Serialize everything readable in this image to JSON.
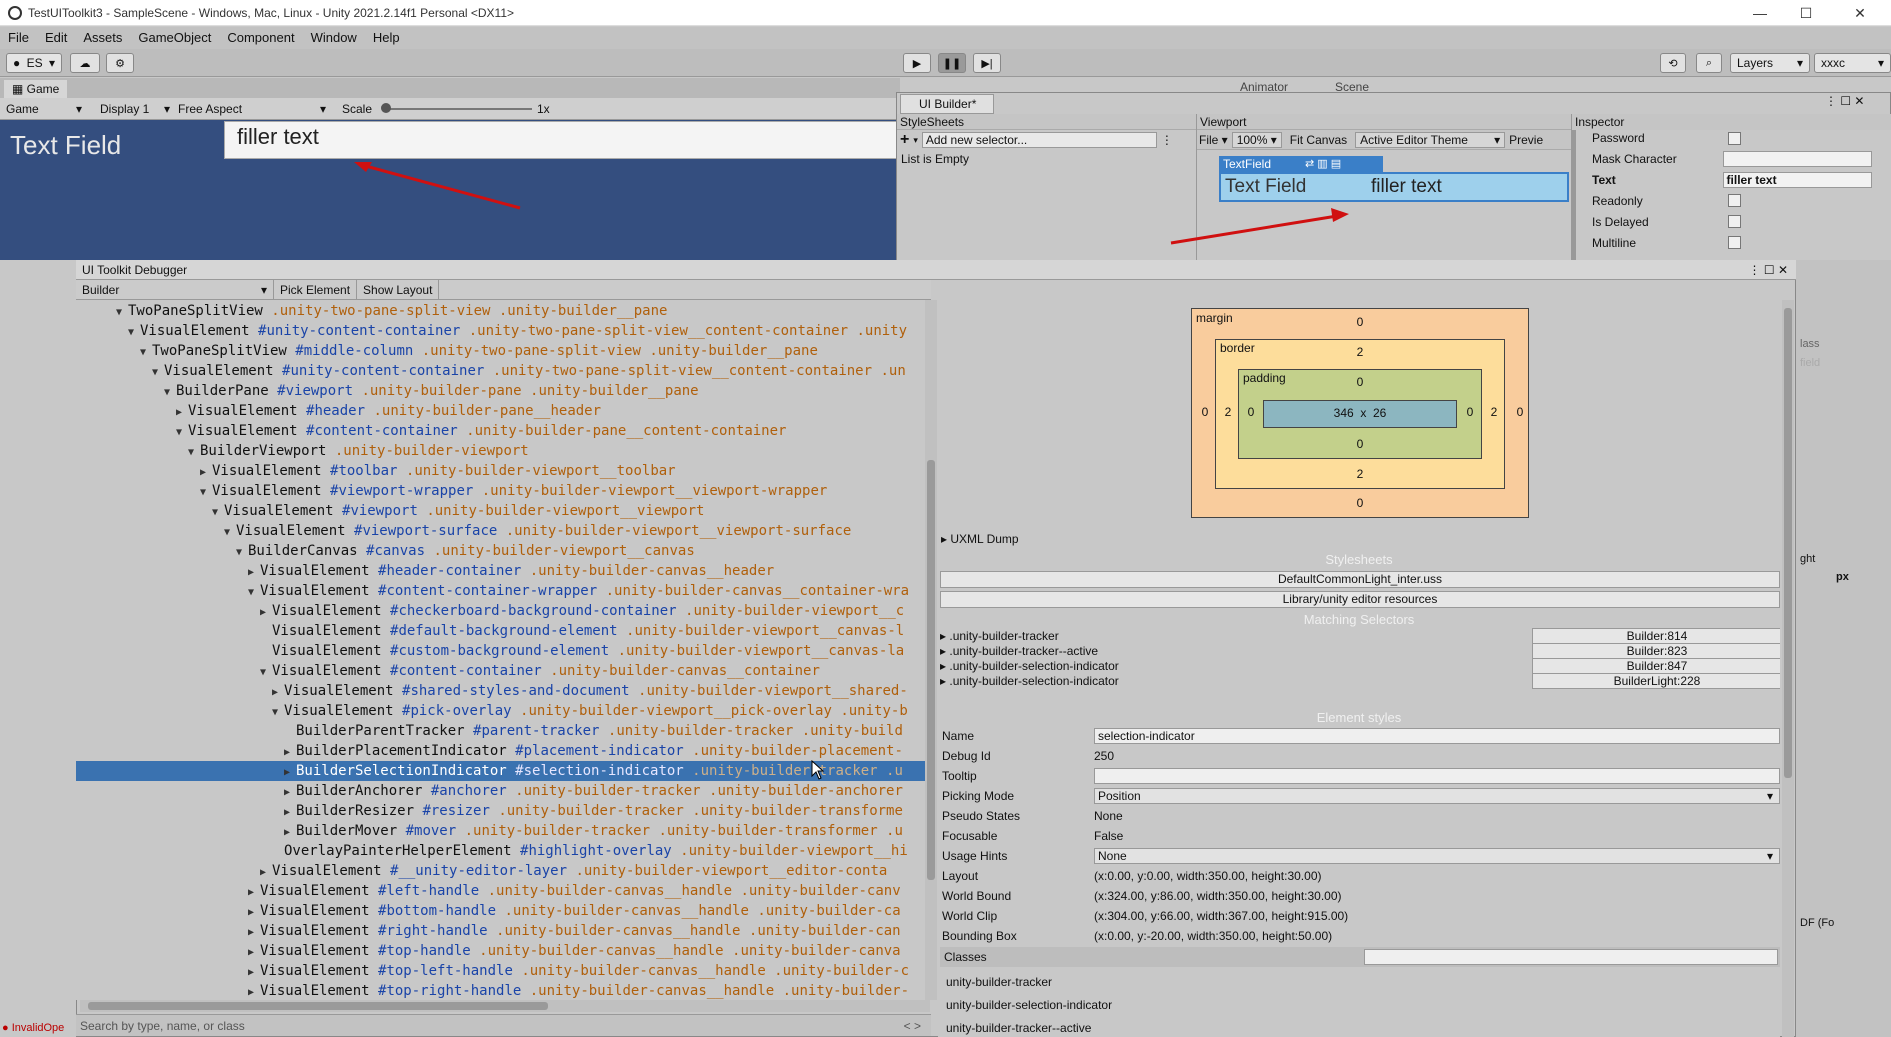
{
  "window": {
    "title": "TestUIToolkit3 - SampleScene - Windows, Mac, Linux - Unity 2021.2.14f1 Personal <DX11>"
  },
  "menu": [
    "File",
    "Edit",
    "Assets",
    "GameObject",
    "Component",
    "Window",
    "Help"
  ],
  "toolbar": {
    "account": "ES",
    "layers": "Layers",
    "layout": "xxxc"
  },
  "game": {
    "tab": "Game",
    "tab_right_1": "Animator",
    "tab_right_2": "Scene",
    "mode": "Game",
    "display": "Display 1",
    "aspect": "Free Aspect",
    "scale_label": "Scale",
    "scale_value": "1x",
    "text_label": "Text Field",
    "field_value": "filler text"
  },
  "builder": {
    "tab": "UI Builder*",
    "stylesheets_header": "StyleSheets",
    "add_selector_placeholder": "Add new selector...",
    "list_empty": "List is Empty",
    "viewport_header": "Viewport",
    "file_menu": "File",
    "zoom": "100%",
    "fit_canvas": "Fit Canvas",
    "theme": "Active Editor Theme",
    "preview": "Previe",
    "textfield_tag": "TextField",
    "textfield_label": "Text Field",
    "textfield_value": "filler text",
    "inspector_header": "Inspector",
    "inspector_rows": [
      {
        "label": "Password",
        "kind": "check"
      },
      {
        "label": "Mask Character",
        "kind": "field",
        "value": ""
      },
      {
        "label": "Text",
        "kind": "field",
        "value": "filler text",
        "bold": true
      },
      {
        "label": "Readonly",
        "kind": "check"
      },
      {
        "label": "Is Delayed",
        "kind": "check"
      },
      {
        "label": "Multiline",
        "kind": "check"
      }
    ]
  },
  "debugger": {
    "title": "UI Toolkit Debugger",
    "panel_select": "Builder",
    "pick_element": "Pick Element",
    "show_layout": "Show Layout",
    "search_placeholder": "Search by type, name, or class",
    "tree": [
      {
        "indent": 4,
        "arrow": "open",
        "type": "TwoPaneSplitView",
        "name": "",
        "cls": ".unity-two-pane-split-view .unity-builder__pane"
      },
      {
        "indent": 5,
        "arrow": "open",
        "type": "VisualElement",
        "name": "#unity-content-container",
        "cls": ".unity-two-pane-split-view__content-container .unity"
      },
      {
        "indent": 6,
        "arrow": "open",
        "type": "TwoPaneSplitView",
        "name": "#middle-column",
        "cls": ".unity-two-pane-split-view .unity-builder__pane"
      },
      {
        "indent": 7,
        "arrow": "open",
        "type": "VisualElement",
        "name": "#unity-content-container",
        "cls": ".unity-two-pane-split-view__content-container .un"
      },
      {
        "indent": 8,
        "arrow": "open",
        "type": "BuilderPane",
        "name": "#viewport",
        "cls": ".unity-builder-pane .unity-builder__pane"
      },
      {
        "indent": 9,
        "arrow": "closed",
        "type": "VisualElement",
        "name": "#header",
        "cls": ".unity-builder-pane__header"
      },
      {
        "indent": 9,
        "arrow": "open",
        "type": "VisualElement",
        "name": "#content-container",
        "cls": ".unity-builder-pane__content-container"
      },
      {
        "indent": 10,
        "arrow": "open",
        "type": "BuilderViewport",
        "name": "",
        "cls": ".unity-builder-viewport"
      },
      {
        "indent": 11,
        "arrow": "closed",
        "type": "VisualElement",
        "name": "#toolbar",
        "cls": ".unity-builder-viewport__toolbar"
      },
      {
        "indent": 11,
        "arrow": "open",
        "type": "VisualElement",
        "name": "#viewport-wrapper",
        "cls": ".unity-builder-viewport__viewport-wrapper"
      },
      {
        "indent": 12,
        "arrow": "open",
        "type": "VisualElement",
        "name": "#viewport",
        "cls": ".unity-builder-viewport__viewport"
      },
      {
        "indent": 13,
        "arrow": "open",
        "type": "VisualElement",
        "name": "#viewport-surface",
        "cls": ".unity-builder-viewport__viewport-surface"
      },
      {
        "indent": 14,
        "arrow": "open",
        "type": "BuilderCanvas",
        "name": "#canvas",
        "cls": ".unity-builder-viewport__canvas"
      },
      {
        "indent": 15,
        "arrow": "closed",
        "type": "VisualElement",
        "name": "#header-container",
        "cls": ".unity-builder-canvas__header"
      },
      {
        "indent": 15,
        "arrow": "open",
        "type": "VisualElement",
        "name": "#content-container-wrapper",
        "cls": ".unity-builder-canvas__container-wra"
      },
      {
        "indent": 16,
        "arrow": "closed",
        "type": "VisualElement",
        "name": "#checkerboard-background-container",
        "cls": ".unity-builder-viewport__c"
      },
      {
        "indent": 16,
        "arrow": "none",
        "type": "VisualElement",
        "name": "#default-background-element",
        "cls": ".unity-builder-viewport__canvas-l"
      },
      {
        "indent": 16,
        "arrow": "none",
        "type": "VisualElement",
        "name": "#custom-background-element",
        "cls": ".unity-builder-viewport__canvas-la"
      },
      {
        "indent": 16,
        "arrow": "open",
        "type": "VisualElement",
        "name": "#content-container",
        "cls": ".unity-builder-canvas__container"
      },
      {
        "indent": 17,
        "arrow": "closed",
        "type": "VisualElement",
        "name": "#shared-styles-and-document",
        "cls": ".unity-builder-viewport__shared-"
      },
      {
        "indent": 17,
        "arrow": "open",
        "type": "VisualElement",
        "name": "#pick-overlay",
        "cls": ".unity-builder-viewport__pick-overlay .unity-b"
      },
      {
        "indent": 18,
        "arrow": "none",
        "type": "BuilderParentTracker",
        "name": "#parent-tracker",
        "cls": ".unity-builder-tracker .unity-build"
      },
      {
        "indent": 18,
        "arrow": "closed",
        "type": "BuilderPlacementIndicator",
        "name": "#placement-indicator",
        "cls": ".unity-builder-placement-"
      },
      {
        "indent": 18,
        "arrow": "closed",
        "type": "BuilderSelectionIndicator",
        "name": "#selection-indicator",
        "cls": ".unity-builder-tracker .u",
        "selected": true
      },
      {
        "indent": 18,
        "arrow": "closed",
        "type": "BuilderAnchorer",
        "name": "#anchorer",
        "cls": ".unity-builder-tracker .unity-builder-anchorer"
      },
      {
        "indent": 18,
        "arrow": "closed",
        "type": "BuilderResizer",
        "name": "#resizer",
        "cls": ".unity-builder-tracker .unity-builder-transforme"
      },
      {
        "indent": 18,
        "arrow": "closed",
        "type": "BuilderMover",
        "name": "#mover",
        "cls": ".unity-builder-tracker .unity-builder-transformer .u"
      },
      {
        "indent": 17,
        "arrow": "none",
        "type": "OverlayPainterHelperElement",
        "name": "#highlight-overlay",
        "cls": ".unity-builder-viewport__hi"
      },
      {
        "indent": 16,
        "arrow": "closed",
        "type": "VisualElement",
        "name": "#__unity-editor-layer",
        "cls": ".unity-builder-viewport__editor-conta"
      },
      {
        "indent": 15,
        "arrow": "closed",
        "type": "VisualElement",
        "name": "#left-handle",
        "cls": ".unity-builder-canvas__handle .unity-builder-canv"
      },
      {
        "indent": 15,
        "arrow": "closed",
        "type": "VisualElement",
        "name": "#bottom-handle",
        "cls": ".unity-builder-canvas__handle .unity-builder-ca"
      },
      {
        "indent": 15,
        "arrow": "closed",
        "type": "VisualElement",
        "name": "#right-handle",
        "cls": ".unity-builder-canvas__handle .unity-builder-can"
      },
      {
        "indent": 15,
        "arrow": "closed",
        "type": "VisualElement",
        "name": "#top-handle",
        "cls": ".unity-builder-canvas__handle .unity-builder-canva"
      },
      {
        "indent": 15,
        "arrow": "closed",
        "type": "VisualElement",
        "name": "#top-left-handle",
        "cls": ".unity-builder-canvas__handle .unity-builder-c"
      },
      {
        "indent": 15,
        "arrow": "closed",
        "type": "VisualElement",
        "name": "#top-right-handle",
        "cls": ".unity-builder-canvas__handle .unity-builder-"
      }
    ],
    "boxmodel": {
      "margin_label": "margin",
      "border_label": "border",
      "padding_label": "padding",
      "margin": {
        "top": "0",
        "right": "0",
        "bottom": "0",
        "left": "0"
      },
      "border": {
        "top": "2",
        "right": "2",
        "bottom": "2",
        "left": "2"
      },
      "padding": {
        "top": "0",
        "right": "0",
        "bottom": "0",
        "left": "0"
      },
      "content": "346  x  26"
    },
    "uxml_dump": "UXML Dump",
    "stylesheets_title": "Stylesheets",
    "stylesheets": [
      "DefaultCommonLight_inter.uss",
      "Library/unity editor resources"
    ],
    "matching_title": "Matching Selectors",
    "matching": [
      {
        "selector": ".unity-builder-tracker",
        "source": "Builder:814"
      },
      {
        "selector": ".unity-builder-tracker--active",
        "source": "Builder:823"
      },
      {
        "selector": ".unity-builder-selection-indicator",
        "source": "Builder:847"
      },
      {
        "selector": ".unity-builder-selection-indicator",
        "source": "BuilderLight:228"
      }
    ],
    "element_styles_title": "Element styles",
    "element": {
      "name_label": "Name",
      "name": "selection-indicator",
      "debug_label": "Debug Id",
      "debug": "250",
      "tooltip_label": "Tooltip",
      "tooltip": "",
      "picking_label": "Picking Mode",
      "picking": "Position",
      "pseudo_label": "Pseudo States",
      "pseudo": "None",
      "focus_label": "Focusable",
      "focus": "False",
      "usage_label": "Usage Hints",
      "usage": "None",
      "layout_label": "Layout",
      "layout": "(x:0.00, y:0.00, width:350.00, height:30.00)",
      "world_label": "World Bound",
      "world": "(x:324.00, y:86.00, width:350.00, height:30.00)",
      "clip_label": "World Clip",
      "clip": "(x:304.00, y:66.00, width:367.00, height:915.00)",
      "bbox_label": "Bounding Box",
      "bbox": "(x:0.00, y:-20.00, width:350.00, height:50.00)"
    },
    "classes_label": "Classes",
    "classes": [
      "unity-builder-tracker",
      "unity-builder-selection-indicator",
      "unity-builder-tracker--active"
    ]
  },
  "status": {
    "error": "InvalidOpe"
  },
  "right_edge": {
    "lass": "lass",
    "field": "field",
    "ght": "ght",
    "px": "px",
    "df": "DF (Fo"
  },
  "colors": {
    "selection": "#3a72b0",
    "game_bg": "#344e7f",
    "margin": "#f9cc9d",
    "border": "#fddd9b",
    "padding": "#c3d08b",
    "content": "#8cb6c0",
    "red_arrow": "#d01010"
  }
}
